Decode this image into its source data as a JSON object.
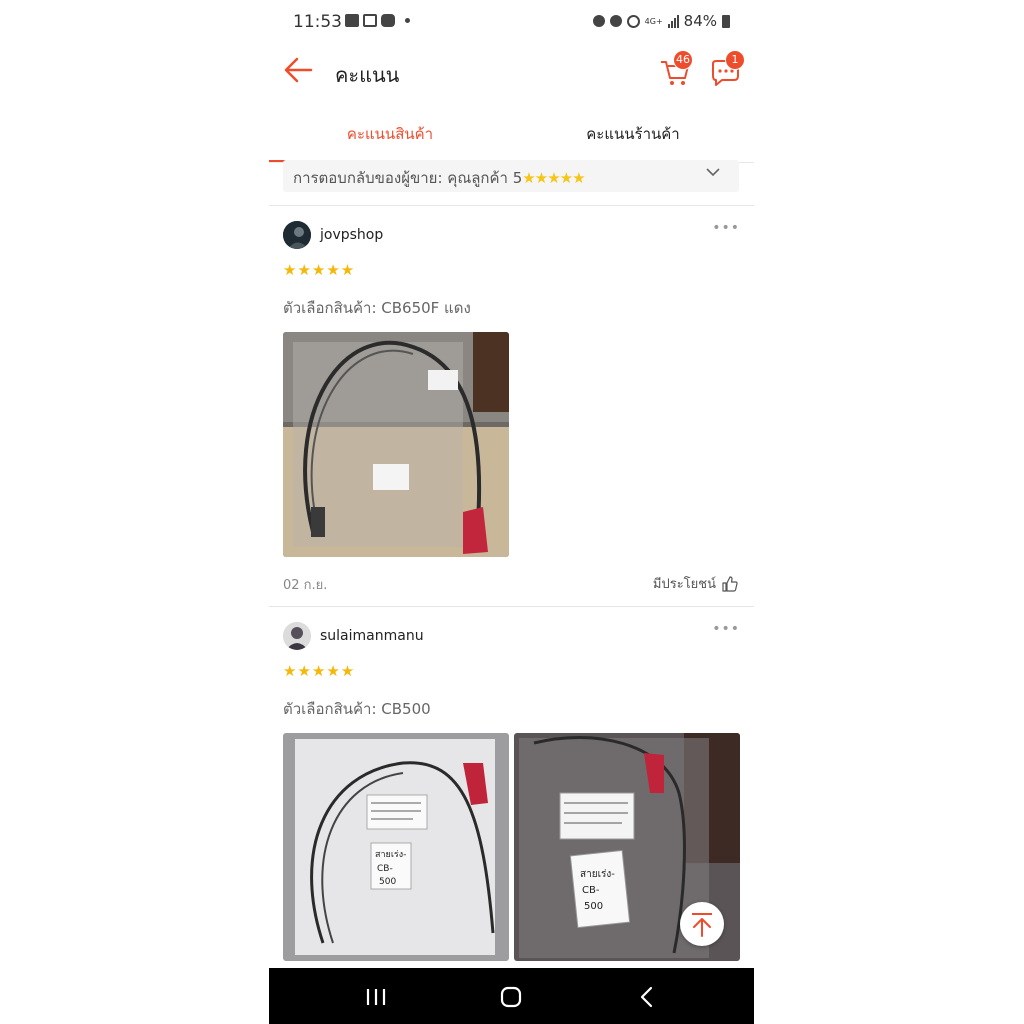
{
  "status_bar": {
    "time": "11:53",
    "battery": "84%",
    "network": "4G+"
  },
  "header": {
    "title": "คะแนน",
    "cart_count": "46",
    "chat_count": "1",
    "accent": "#ee4d2d"
  },
  "tabs": [
    {
      "label": "คะแนนสินค้า",
      "active": true
    },
    {
      "label": "คะแนนร้านค้า",
      "active": false
    }
  ],
  "filter": {
    "label": "การตอบกลับของผู้ขาย: คุณลูกค้า 5",
    "stars": "★★★★★"
  },
  "reviews": [
    {
      "username": "jovpshop",
      "rating_stars": "★★★★★",
      "rating": 5,
      "variation": "ตัวเลือกสินค้า: CB650F แดง",
      "date": "02 ก.ย.",
      "helpful_label": "มีประโยชน์"
    },
    {
      "username": "sulaimanmanu",
      "rating_stars": "★★★★★",
      "rating": 5,
      "variation": "ตัวเลือกสินค้า: CB500"
    }
  ],
  "photo_labels": {
    "label_a": "สายเร่ง-",
    "label_b": "CB-",
    "label_c": "500"
  },
  "icons": {
    "back": "arrow-left-icon",
    "cart": "shopping-cart-icon",
    "chat": "chat-bubble-icon",
    "more": "more-dots-icon",
    "helpful": "thumbs-up-icon",
    "scroll_top": "arrow-up-to-top-icon"
  }
}
